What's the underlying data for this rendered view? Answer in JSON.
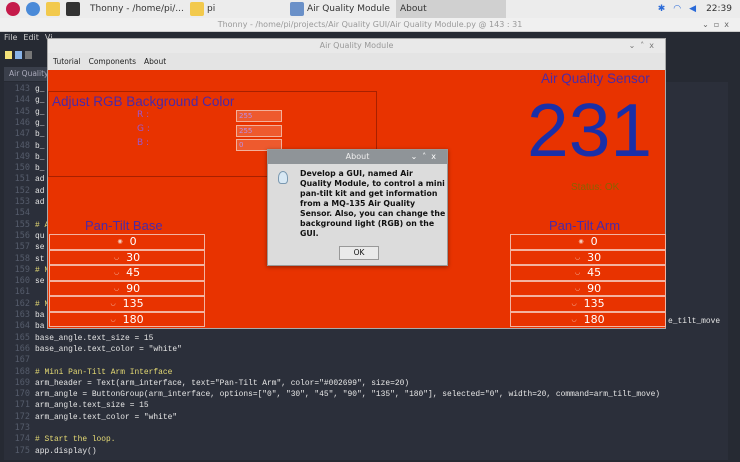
{
  "taskbar": {
    "tasks": [
      "Thonny - /home/pi/...",
      "pi",
      "Air Quality Module",
      "About"
    ],
    "clock": "22:39"
  },
  "thonny": {
    "title": "Thonny - /home/pi/projects/Air Quality GUI/Air Quality Module.py @ 143 : 31",
    "menu": [
      "File",
      "Edit",
      "Vi"
    ],
    "tab": "Air Quality",
    "lines": [
      {
        "n": "143",
        "t": "g_"
      },
      {
        "n": "144",
        "t": "g_"
      },
      {
        "n": "145",
        "t": "g_"
      },
      {
        "n": "146",
        "t": "g_"
      },
      {
        "n": "147",
        "t": "b_"
      },
      {
        "n": "148",
        "t": "b_"
      },
      {
        "n": "149",
        "t": "b_"
      },
      {
        "n": "150",
        "t": "b_"
      },
      {
        "n": "151",
        "t": "ad"
      },
      {
        "n": "152",
        "t": "ad"
      },
      {
        "n": "153",
        "t": "ad"
      },
      {
        "n": "154",
        "t": ""
      },
      {
        "n": "155",
        "t": "# A"
      },
      {
        "n": "156",
        "t": "qu"
      },
      {
        "n": "157",
        "t": "se"
      },
      {
        "n": "158",
        "t": "st"
      },
      {
        "n": "159",
        "t": "# M"
      },
      {
        "n": "160",
        "t": "se"
      },
      {
        "n": "161",
        "t": ""
      },
      {
        "n": "162",
        "t": "# M"
      },
      {
        "n": "163",
        "t": "ba"
      },
      {
        "n": "164",
        "t": "ba"
      },
      {
        "n": "165",
        "t": "base_angle.text_size = 15"
      },
      {
        "n": "166",
        "t": "base_angle.text_color = \"white\""
      },
      {
        "n": "167",
        "t": ""
      },
      {
        "n": "168",
        "t": "# Mini Pan-Tilt Arm Interface"
      },
      {
        "n": "169",
        "t": "arm_header = Text(arm_interface, text=\"Pan-Tilt Arm\", color=\"#002699\", size=20)"
      },
      {
        "n": "170",
        "t": "arm_angle = ButtonGroup(arm_interface, options=[\"0\", \"30\", \"45\", \"90\", \"135\", \"180\"], selected=\"0\", width=20, command=arm_tilt_move)"
      },
      {
        "n": "171",
        "t": "arm_angle.text_size = 15"
      },
      {
        "n": "172",
        "t": "arm_angle.text_color = \"white\""
      },
      {
        "n": "173",
        "t": ""
      },
      {
        "n": "174",
        "t": "# Start the loop."
      },
      {
        "n": "175",
        "t": "app.display()"
      }
    ],
    "line164_tail": "e_tilt_move"
  },
  "app": {
    "title": "Air Quality Module",
    "menu": [
      "Tutorial",
      "Components",
      "About"
    ],
    "bg_color": "#e83300",
    "rgb": {
      "title": "Adjust RGB Background Color",
      "labels": [
        "R :",
        "G :",
        "B :"
      ],
      "values": [
        "255",
        "255",
        "0"
      ]
    },
    "base": {
      "title": "Pan-Tilt Base",
      "options": [
        "0",
        "30",
        "45",
        "90",
        "135",
        "180"
      ],
      "selected": "0"
    },
    "arm": {
      "title": "Pan-Tilt Arm",
      "options": [
        "0",
        "30",
        "45",
        "90",
        "135",
        "180"
      ],
      "selected": "0"
    },
    "sensor": {
      "title": "Air Quality Sensor",
      "reading": "231",
      "status": "Status: OK"
    }
  },
  "about": {
    "title": "About",
    "message": "Develop a GUI, named Air Quality Module, to control a mini pan-tilt kit and get information from a MQ-135 Air Quality Sensor. Also, you can change the background light (RGB) on the GUI.",
    "ok": "OK"
  }
}
